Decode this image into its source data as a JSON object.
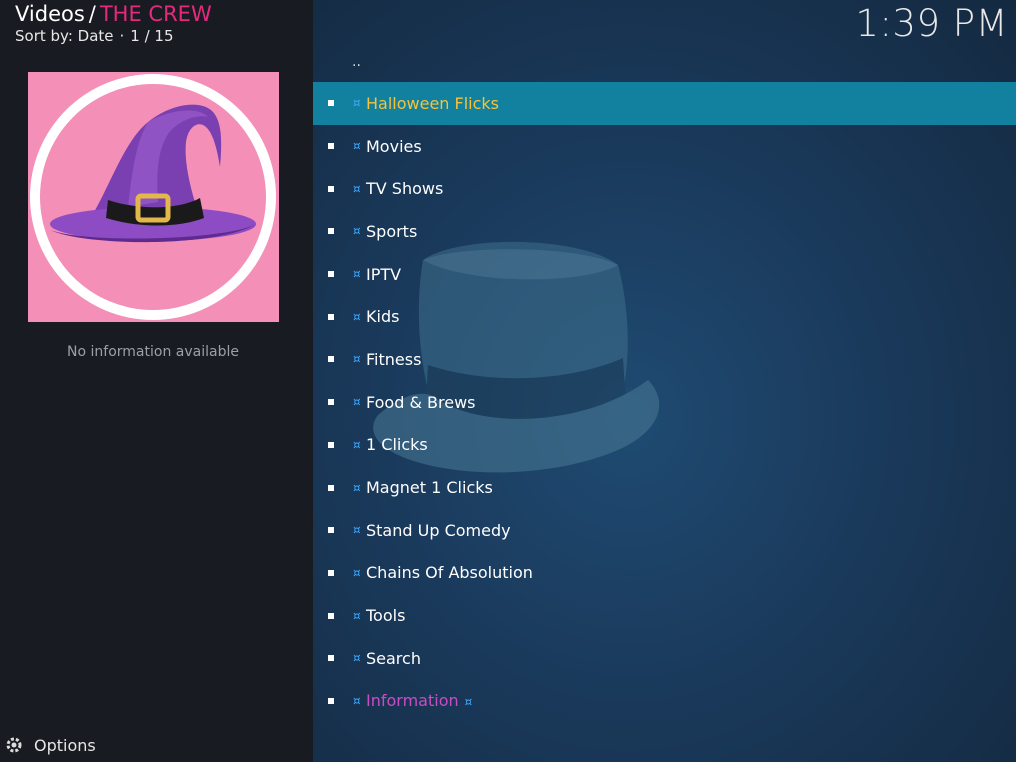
{
  "header": {
    "section": "Videos",
    "separator": "/",
    "addon": "THE CREW",
    "sort_label": "Sort by: Date",
    "dot": "·",
    "position": "1 / 15"
  },
  "info_panel": {
    "message": "No information available"
  },
  "clock": "1:39 PM",
  "options_label": "Options",
  "list": {
    "parent": "..",
    "glyph": "¤",
    "items": [
      {
        "label": "Halloween Flicks"
      },
      {
        "label": "Movies"
      },
      {
        "label": "TV Shows"
      },
      {
        "label": "Sports"
      },
      {
        "label": "IPTV"
      },
      {
        "label": "Kids"
      },
      {
        "label": "Fitness"
      },
      {
        "label": "Food & Brews"
      },
      {
        "label": "1 Clicks"
      },
      {
        "label": "Magnet 1 Clicks"
      },
      {
        "label": "Stand Up Comedy"
      },
      {
        "label": "Chains Of Absolution"
      },
      {
        "label": "Tools"
      },
      {
        "label": "Search"
      },
      {
        "label": "Information"
      }
    ]
  },
  "colors": {
    "accent_addon": "#e6297e",
    "focus_bg": "#12809f",
    "focus_text": "#f5c33b",
    "glyph": "#3fa9ff",
    "info_text": "#c84dc4"
  },
  "icons": {
    "thumbnail": "witch-hat-icon",
    "background": "bowler-hat-icon",
    "options": "gear-icon"
  }
}
